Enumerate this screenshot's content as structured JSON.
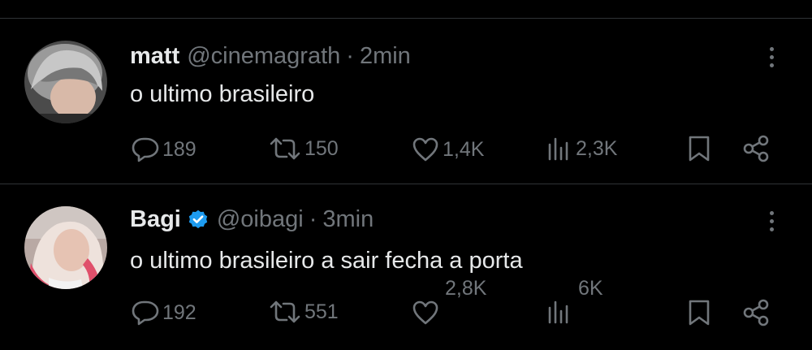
{
  "tweets": [
    {
      "name": "matt",
      "handle": "@cinemagrath",
      "dot": "·",
      "time": "2min",
      "text": "o ultimo brasileiro",
      "verified": false,
      "replies": "189",
      "retweets": "150",
      "likes": "1,4K",
      "views": "2,3K"
    },
    {
      "name": "Bagi",
      "handle": "@oibagi",
      "dot": "·",
      "time": "3min",
      "text": "o ultimo brasileiro a sair fecha a porta",
      "verified": true,
      "replies": "192",
      "retweets": "551",
      "likes": "2,8K",
      "views": "6K"
    }
  ],
  "colors": {
    "background": "#000000",
    "text": "#e7e9ea",
    "muted": "#71767b",
    "divider": "#2f3336",
    "verified": "#1d9bf0"
  },
  "icons": [
    "more-icon",
    "reply-icon",
    "retweet-icon",
    "like-icon",
    "views-icon",
    "bookmark-icon",
    "share-icon",
    "verified-badge-icon"
  ]
}
